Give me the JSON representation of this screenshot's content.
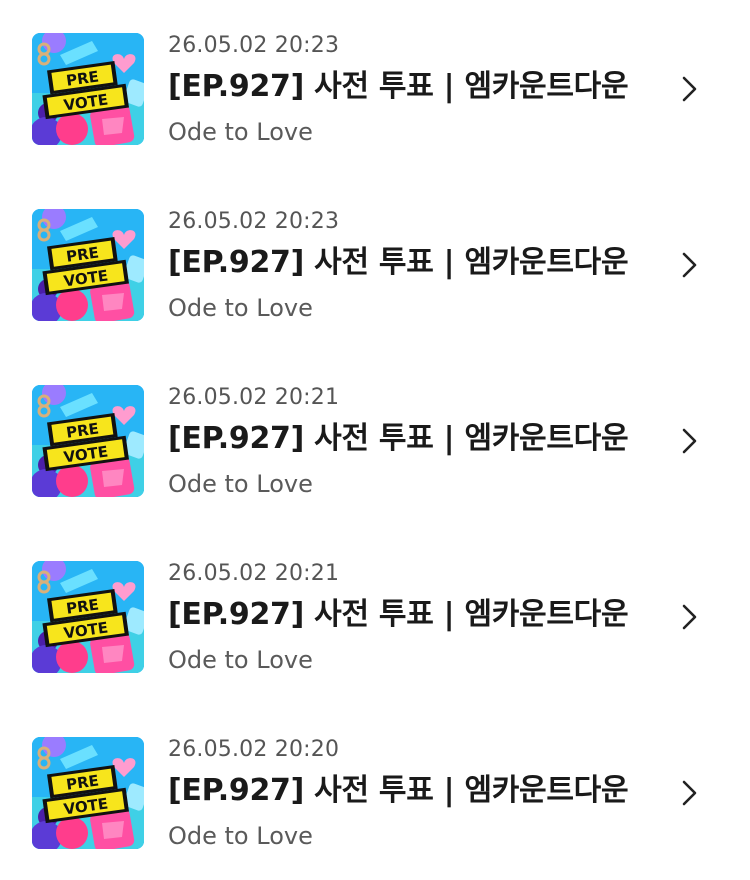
{
  "history": {
    "items": [
      {
        "date": "26.05.02 20:23",
        "title": "[EP.927] 사전 투표 | 엠카운트다운",
        "subtitle": "Ode to Love",
        "badge_line1": "PRE",
        "badge_line2": "VOTE"
      },
      {
        "date": "26.05.02 20:23",
        "title": "[EP.927] 사전 투표 | 엠카운트다운",
        "subtitle": "Ode to Love",
        "badge_line1": "PRE",
        "badge_line2": "VOTE"
      },
      {
        "date": "26.05.02 20:21",
        "title": "[EP.927] 사전 투표 | 엠카운트다운",
        "subtitle": "Ode to Love",
        "badge_line1": "PRE",
        "badge_line2": "VOTE"
      },
      {
        "date": "26.05.02 20:21",
        "title": "[EP.927] 사전 투표 | 엠카운트다운",
        "subtitle": "Ode to Love",
        "badge_line1": "PRE",
        "badge_line2": "VOTE"
      },
      {
        "date": "26.05.02 20:20",
        "title": "[EP.927] 사전 투표 | 엠카운트다운",
        "subtitle": "Ode to Love",
        "badge_line1": "PRE",
        "badge_line2": "VOTE"
      }
    ]
  },
  "icons": {
    "chevron": "chevron-right-icon",
    "thumbnail": "pre-vote-thumbnail"
  },
  "colors": {
    "thumb_background": "#28b5f5",
    "badge_black": "#111111",
    "badge_yellow": "#f7e51c",
    "accent_pink": "#ff3d8c",
    "accent_purple": "#5b3bd6",
    "title_text": "#1a1a1a",
    "meta_text": "#555555"
  }
}
